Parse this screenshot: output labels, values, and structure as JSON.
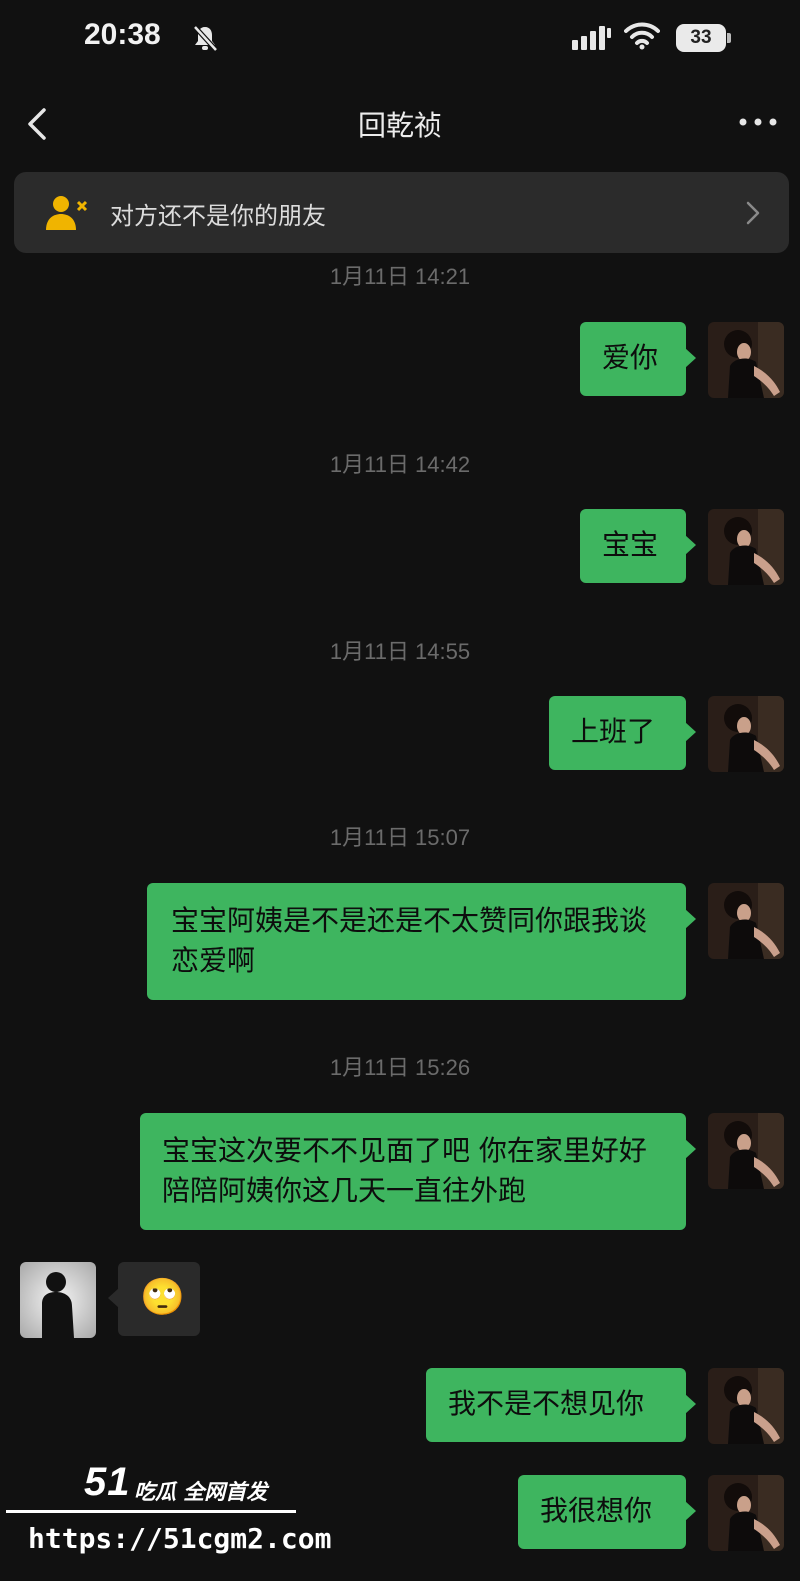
{
  "status_bar": {
    "time": "20:38",
    "battery": "33"
  },
  "header": {
    "title": "回乾祯"
  },
  "banner": {
    "text": "对方还不是你的朋友"
  },
  "messages": [
    {
      "timestamp": "1月11日 14:21",
      "text": "爱你"
    },
    {
      "timestamp": "1月11日 14:42",
      "text": "宝宝"
    },
    {
      "timestamp": "1月11日 14:55",
      "text": "上班了"
    },
    {
      "timestamp": "1月11日 15:07",
      "text": "宝宝阿姨是不是还是不太赞同你跟我谈恋爱啊"
    },
    {
      "timestamp": "1月11日 15:26",
      "text": "宝宝这次要不不见面了吧 你在家里好好陪陪阿姨你这几天一直往外跑"
    },
    {
      "incoming_emoji": "🙄"
    },
    {
      "text": "我不是不想见你"
    },
    {
      "text": "我很想你"
    }
  ],
  "watermark": {
    "logo": "51",
    "name": "吃瓜 全网首发",
    "url": "https://51cgm2.com"
  },
  "colors": {
    "background": "#111111",
    "bubble_out": "#3eb55f",
    "bubble_in": "#2a2a2a",
    "banner": "#2b2b2b",
    "timestamp": "#6b6b6b",
    "warning_icon": "#f0b400"
  }
}
